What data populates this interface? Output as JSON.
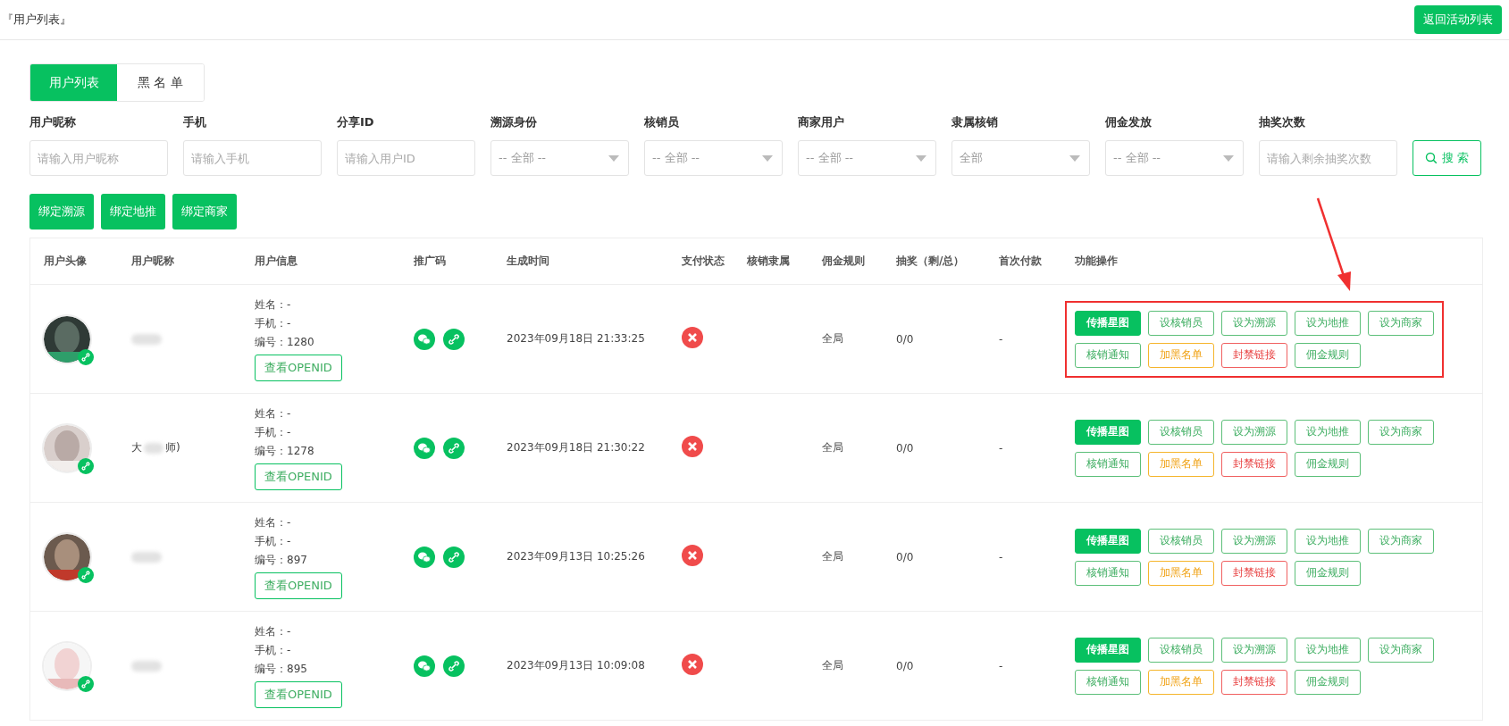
{
  "header": {
    "title": "『用户列表』",
    "back_button": "返回活动列表"
  },
  "tabs": [
    {
      "label": "用户列表",
      "selected": true
    },
    {
      "label": "黑 名 单",
      "selected": false
    }
  ],
  "filters": [
    {
      "kind": "input",
      "label": "用户昵称",
      "placeholder": "请输入用户昵称"
    },
    {
      "kind": "input",
      "label": "手机",
      "placeholder": "请输入手机"
    },
    {
      "kind": "input",
      "label": "分享ID",
      "placeholder": "请输入用户ID"
    },
    {
      "kind": "select",
      "label": "溯源身份",
      "value": "-- 全部 --"
    },
    {
      "kind": "select",
      "label": "核销员",
      "value": "-- 全部 --"
    },
    {
      "kind": "select",
      "label": "商家用户",
      "value": "-- 全部 --"
    },
    {
      "kind": "select",
      "label": "隶属核销",
      "value": "全部"
    },
    {
      "kind": "select",
      "label": "佣金发放",
      "value": "-- 全部 --"
    },
    {
      "kind": "input",
      "label": "抽奖次数",
      "placeholder": "请输入剩余抽奖次数"
    }
  ],
  "search_button": "搜 索",
  "bind_buttons": [
    "绑定溯源",
    "绑定地推",
    "绑定商家"
  ],
  "table": {
    "columns": [
      "用户头像",
      "用户昵称",
      "用户信息",
      "推广码",
      "生成时间",
      "支付状态",
      "核销隶属",
      "佣金规则",
      "抽奖（剩/总）",
      "首次付款",
      "功能操作"
    ],
    "rows": [
      {
        "nickname": [],
        "info": [
          "姓名：-",
          "手机：-",
          "编号：1280"
        ],
        "openid_button": "查看OPENID",
        "time": "2023年09月18日 21:33:25",
        "paid": false,
        "rule": "全局",
        "draws": "0/0",
        "first_payment": "-",
        "highlighted": true,
        "actions": [
          {
            "label": "传播星图",
            "kind": "primary"
          },
          {
            "label": "设核销员",
            "kind": "outline"
          },
          {
            "label": "设为溯源",
            "kind": "outline"
          },
          {
            "label": "设为地推",
            "kind": "outline"
          },
          {
            "label": "设为商家",
            "kind": "outline"
          },
          {
            "label": "核销通知",
            "kind": "outline"
          },
          {
            "label": "加黑名单",
            "kind": "warning"
          },
          {
            "label": "封禁链接",
            "kind": "danger"
          },
          {
            "label": "佣金规则",
            "kind": "outline"
          }
        ]
      },
      {
        "nickname": [
          "大",
          "师)"
        ],
        "info": [
          "姓名：-",
          "手机：-",
          "编号：1278"
        ],
        "openid_button": "查看OPENID",
        "time": "2023年09月18日 21:30:22",
        "paid": false,
        "rule": "全局",
        "draws": "0/0",
        "first_payment": "-",
        "highlighted": false,
        "actions": [
          {
            "label": "传播星图",
            "kind": "primary"
          },
          {
            "label": "设核销员",
            "kind": "outline"
          },
          {
            "label": "设为溯源",
            "kind": "outline"
          },
          {
            "label": "设为地推",
            "kind": "outline"
          },
          {
            "label": "设为商家",
            "kind": "outline"
          },
          {
            "label": "核销通知",
            "kind": "outline"
          },
          {
            "label": "加黑名单",
            "kind": "warning"
          },
          {
            "label": "封禁链接",
            "kind": "danger"
          },
          {
            "label": "佣金规则",
            "kind": "outline"
          }
        ]
      },
      {
        "nickname": [],
        "info": [
          "姓名：-",
          "手机：-",
          "编号：897"
        ],
        "openid_button": "查看OPENID",
        "time": "2023年09月13日 10:25:26",
        "paid": false,
        "rule": "全局",
        "draws": "0/0",
        "first_payment": "-",
        "highlighted": false,
        "actions": [
          {
            "label": "传播星图",
            "kind": "primary"
          },
          {
            "label": "设核销员",
            "kind": "outline"
          },
          {
            "label": "设为溯源",
            "kind": "outline"
          },
          {
            "label": "设为地推",
            "kind": "outline"
          },
          {
            "label": "设为商家",
            "kind": "outline"
          },
          {
            "label": "核销通知",
            "kind": "outline"
          },
          {
            "label": "加黑名单",
            "kind": "warning"
          },
          {
            "label": "封禁链接",
            "kind": "danger"
          },
          {
            "label": "佣金规则",
            "kind": "outline"
          }
        ]
      },
      {
        "nickname": [],
        "info": [
          "姓名：-",
          "手机：-",
          "编号：895"
        ],
        "openid_button": "查看OPENID",
        "time": "2023年09月13日 10:09:08",
        "paid": false,
        "rule": "全局",
        "draws": "0/0",
        "first_payment": "-",
        "highlighted": false,
        "actions": [
          {
            "label": "传播星图",
            "kind": "primary"
          },
          {
            "label": "设核销员",
            "kind": "outline"
          },
          {
            "label": "设为溯源",
            "kind": "outline"
          },
          {
            "label": "设为地推",
            "kind": "outline"
          },
          {
            "label": "设为商家",
            "kind": "outline"
          },
          {
            "label": "核销通知",
            "kind": "outline"
          },
          {
            "label": "加黑名单",
            "kind": "warning"
          },
          {
            "label": "封禁链接",
            "kind": "danger"
          },
          {
            "label": "佣金规则",
            "kind": "outline"
          }
        ]
      }
    ]
  }
}
